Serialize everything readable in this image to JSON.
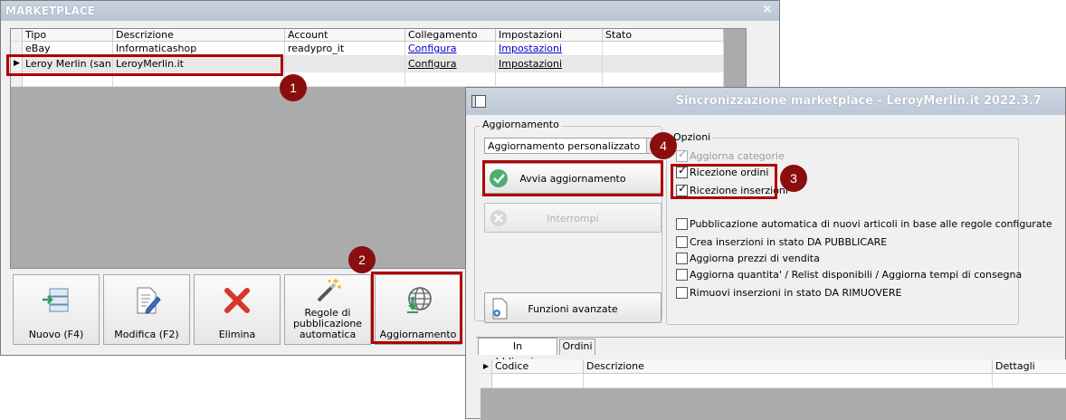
{
  "marketplace": {
    "title": "MARKETPLACE",
    "close_glyph": "×",
    "columns": [
      "Tipo",
      "Descrizione",
      "Account",
      "Collegamento",
      "Impostazioni",
      "Stato"
    ],
    "rows": [
      {
        "tipo": "eBay",
        "descrizione": "Informaticashop",
        "account": "readypro_it",
        "collegamento": "Configura",
        "impostazioni": "Impostazioni",
        "stato": ""
      },
      {
        "tipo": "Leroy Merlin (san...",
        "descrizione": "LeroyMerlin.it",
        "account": "",
        "collegamento": "Configura",
        "impostazioni": "Impostazioni",
        "stato": ""
      }
    ],
    "toolbar": {
      "nuovo": "Nuovo (F4)",
      "modifica": "Modifica (F2)",
      "elimina": "Elimina",
      "regole": "Regole di pubblicazione automatica",
      "aggiornamento": "Aggiornamento"
    }
  },
  "callouts": [
    "1",
    "2",
    "3",
    "4"
  ],
  "sync": {
    "title": "Sincronizzazione marketplace - LeroyMerlin.it 2022.3.7",
    "aggiornamento_group": "Aggiornamento",
    "mode_select": "Aggiornamento personalizzato",
    "avvia_label": "Avvia aggiornamento",
    "interrompi_label": "Interrompi",
    "funzioni_label": "Funzioni avanzate",
    "opzioni_group": "Opzioni",
    "options": [
      {
        "label": "Aggiorna categorie",
        "checked": true,
        "disabled": true
      },
      {
        "label": "Ricezione ordini",
        "checked": true,
        "disabled": false
      },
      {
        "label": "Ricezione inserzioni",
        "checked": true,
        "disabled": false
      },
      {
        "label": "Pubblicazione automatica di nuovi articoli in base alle regole configurate",
        "checked": false,
        "disabled": false
      },
      {
        "label": "Crea inserzioni in stato DA PUBBLICARE",
        "checked": false,
        "disabled": false
      },
      {
        "label": "Aggiorna prezzi di vendita",
        "checked": false,
        "disabled": false
      },
      {
        "label": "Aggiorna quantita' / Relist disponibili / Aggiorna tempi di consegna",
        "checked": false,
        "disabled": false
      },
      {
        "label": "Rimuovi inserzioni in stato DA RIMUOVERE",
        "checked": false,
        "disabled": false
      }
    ],
    "tabs": [
      "In pubblicazione",
      "Ordini"
    ],
    "grid_columns": [
      "Codice",
      "Descrizione",
      "Dettagli"
    ]
  },
  "colors": {
    "callout": "#8b0e0e",
    "highlight": "#b00000",
    "check_green": "#4caf70"
  }
}
